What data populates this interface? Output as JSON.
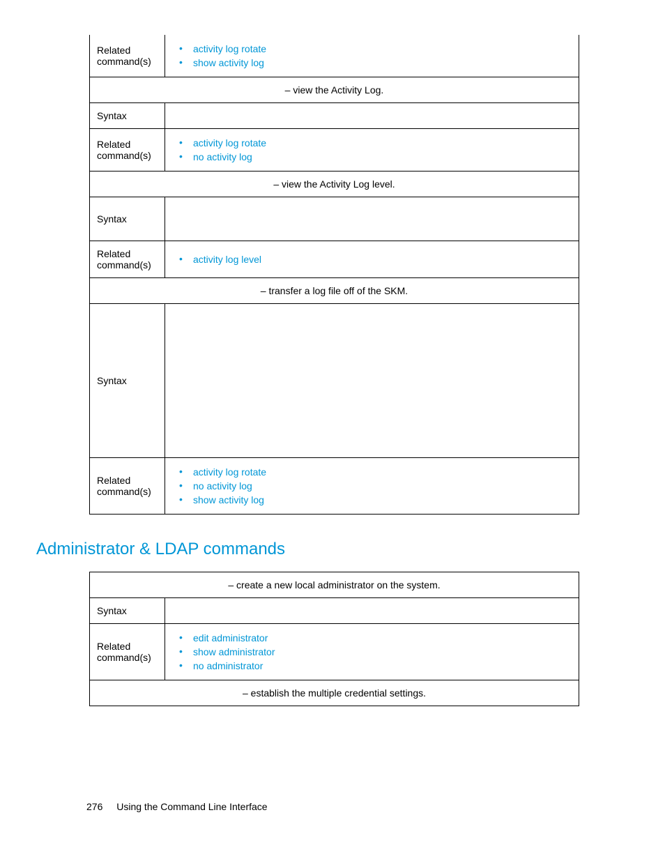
{
  "table1": {
    "rows": [
      {
        "type": "kv",
        "label": "Related command(s)",
        "bullets": [
          "activity log rotate",
          "show activity log"
        ]
      },
      {
        "type": "section",
        "text": "– view the Activity Log."
      },
      {
        "type": "kv",
        "label": "Syntax",
        "blank": true
      },
      {
        "type": "kv",
        "label": "Related command(s)",
        "bullets": [
          "activity log rotate",
          "no activity log"
        ]
      },
      {
        "type": "section",
        "text": "– view the Activity Log level."
      },
      {
        "type": "kv",
        "label": "Syntax",
        "blank": true,
        "height": "med"
      },
      {
        "type": "kv",
        "label": "Related command(s)",
        "bullets": [
          "activity log level"
        ]
      },
      {
        "type": "section",
        "text": "– transfer a log file off of the SKM."
      },
      {
        "type": "kv",
        "label": "Syntax",
        "blank": true,
        "height": "tall"
      },
      {
        "type": "kv",
        "label": "Related command(s)",
        "bullets": [
          "activity log rotate",
          "no activity log",
          "show activity log"
        ]
      }
    ]
  },
  "heading": "Administrator & LDAP commands",
  "table2": {
    "rows": [
      {
        "type": "section",
        "text": "– create a new local administrator on the system."
      },
      {
        "type": "kv",
        "label": "Syntax",
        "blank": true
      },
      {
        "type": "kv",
        "label": "Related command(s)",
        "bullets": [
          "edit administrator",
          "show administrator",
          "no administrator"
        ]
      },
      {
        "type": "section",
        "text": "– establish the multiple credential settings."
      }
    ]
  },
  "footer": {
    "page": "276",
    "title": "Using the Command Line Interface"
  }
}
